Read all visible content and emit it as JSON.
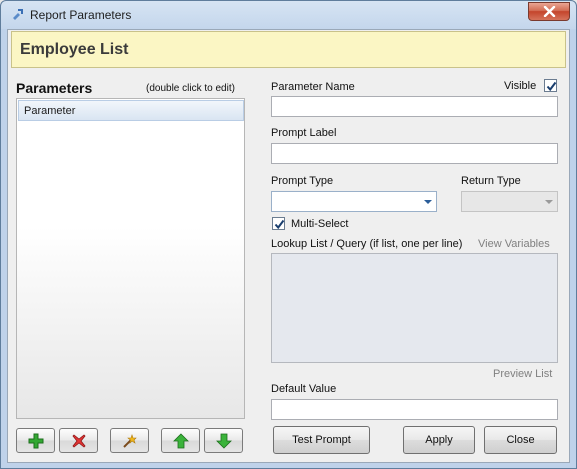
{
  "window": {
    "title": "Report Parameters"
  },
  "header": {
    "title": "Employee List"
  },
  "parameters_panel": {
    "heading": "Parameters",
    "hint": "(double click to edit)",
    "items": [
      {
        "label": "Parameter"
      }
    ]
  },
  "toolbar": {
    "icons": [
      "add-icon",
      "delete-icon",
      "wizard-icon",
      "move-up-icon",
      "move-down-icon"
    ]
  },
  "form": {
    "parameter_name": {
      "label": "Parameter Name",
      "value": ""
    },
    "visible": {
      "label": "Visible",
      "checked": true
    },
    "prompt_label": {
      "label": "Prompt Label",
      "value": ""
    },
    "prompt_type": {
      "label": "Prompt Type",
      "value": ""
    },
    "return_type": {
      "label": "Return Type",
      "value": "",
      "enabled": false
    },
    "multi_select": {
      "label": "Multi-Select",
      "checked": true
    },
    "lookup": {
      "label": "Lookup List / Query (if list, one per line)",
      "view_variables": "View Variables",
      "value": ""
    },
    "preview_list": "Preview List",
    "default_value": {
      "label": "Default Value",
      "value": ""
    }
  },
  "buttons": {
    "test_prompt": "Test Prompt",
    "apply": "Apply",
    "close": "Close"
  },
  "colors": {
    "banner": "#fbf6c4",
    "selection": "#d9e5f2",
    "add_icon": "#2e9d2e",
    "delete_icon": "#d22b2b"
  }
}
